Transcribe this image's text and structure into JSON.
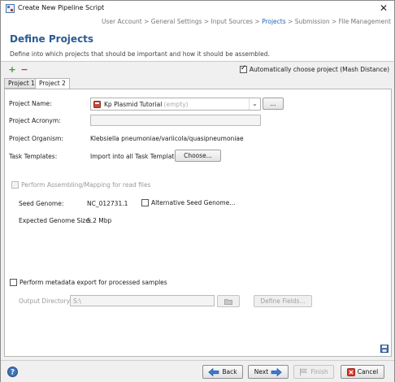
{
  "window": {
    "title": "Create New Pipeline Script",
    "close_glyph": "✕"
  },
  "breadcrumb": {
    "before": "User Account > General Settings > Input Sources > ",
    "active": "Projects",
    "after": " > Submission > File Management"
  },
  "header": {
    "title": "Define Projects",
    "description": "Define into which projects that should be important and how it should be assembled."
  },
  "toolbar": {
    "add_glyph": "+",
    "remove_glyph": "−"
  },
  "auto_choose": {
    "label": "Automatically choose project (Mash Distance)",
    "checked": true
  },
  "tabs": [
    {
      "label": "Project 1",
      "selected": false
    },
    {
      "label": "Project 2",
      "selected": true
    }
  ],
  "form": {
    "project_name_label": "Project Name:",
    "project_name_value": "Kp Plasmid Tutorial",
    "project_name_suffix": "(empty)",
    "browse_label": "...",
    "acronym_label": "Project Acronym:",
    "acronym_value": "",
    "organism_label": "Project Organism:",
    "organism_value": "Klebsiella pneumoniae/variicola/quasipneumoniae",
    "task_templates_label": "Task Templates:",
    "task_templates_value": "Import into all Task Templates",
    "choose_label": "Choose...",
    "assembling_label": "Perform Assembling/Mapping for read files",
    "seed_genome_label": "Seed Genome:",
    "seed_genome_value": "NC_012731.1",
    "alt_seed_label": "Alternative Seed Genome...",
    "genome_size_label": "Expected Genome Size:",
    "genome_size_value": "5.2 Mbp",
    "metadata_export_label": "Perform metadata export for processed samples",
    "output_dir_label": "Output Directory:",
    "output_dir_value": "S:\\",
    "define_fields_label": "Define Fields..."
  },
  "bottom": {
    "back_label": "Back",
    "next_label": "Next",
    "finish_label": "Finish",
    "cancel_label": "Cancel"
  },
  "colors": {
    "accent": "#2b5b93",
    "add_green": "#3a9b2e",
    "remove_red": "#d33b2c"
  }
}
